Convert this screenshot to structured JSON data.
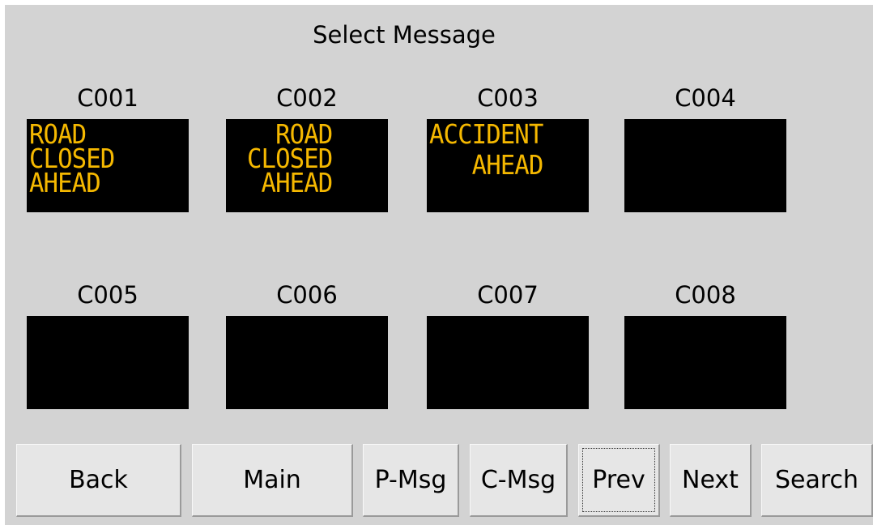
{
  "title": "Select Message",
  "messages": [
    {
      "label": "C001",
      "lines": [
        "ROAD",
        "CLOSED",
        "AHEAD"
      ]
    },
    {
      "label": "C002",
      "lines": [
        "  ROAD",
        "CLOSED",
        " AHEAD"
      ]
    },
    {
      "label": "C003",
      "lines": [
        "ACCIDENT",
        "   AHEAD",
        ""
      ]
    },
    {
      "label": "C004",
      "lines": [
        "",
        "",
        ""
      ]
    },
    {
      "label": "C005",
      "lines": [
        "",
        "",
        ""
      ]
    },
    {
      "label": "C006",
      "lines": [
        "",
        "",
        ""
      ]
    },
    {
      "label": "C007",
      "lines": [
        "",
        "",
        ""
      ]
    },
    {
      "label": "C008",
      "lines": [
        "",
        "",
        ""
      ]
    }
  ],
  "buttons": {
    "back": "Back",
    "main": "Main",
    "p_msg": "P-Msg",
    "c_msg": "C-Msg",
    "prev": "Prev",
    "next": "Next",
    "search": "Search"
  },
  "colors": {
    "background": "#d3d3d3",
    "sign_background": "#000000",
    "sign_text": "#f5b800"
  }
}
